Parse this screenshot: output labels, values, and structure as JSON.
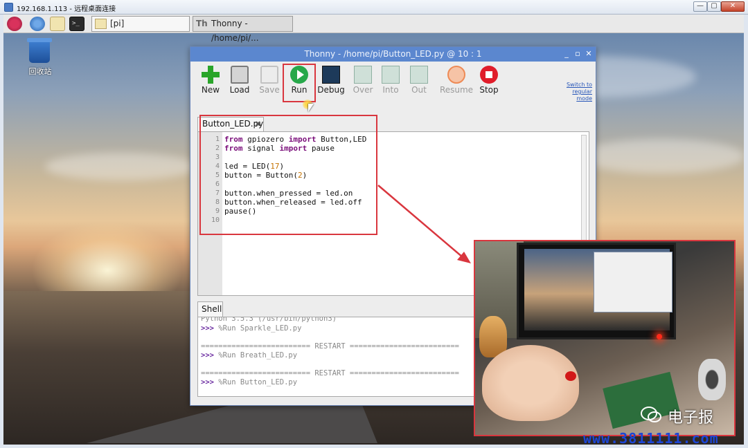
{
  "rdp": {
    "title": "192.168.1.113 - 远程桌面连接",
    "controls": {
      "minimize": "—",
      "maximize": "▢",
      "close": "✕"
    }
  },
  "taskbar": {
    "terminal_glyph": ">_",
    "tasks": [
      {
        "label": "[pi]"
      },
      {
        "label": "Thonny  -  /home/pi/..."
      }
    ]
  },
  "desktop": {
    "trash_label": "回收站"
  },
  "thonny": {
    "title": "Thonny  -  /home/pi/Button_LED.py  @  10 : 1",
    "window_controls": {
      "minimize": "_",
      "maximize": "▫",
      "close": "✕"
    },
    "toolbar": [
      {
        "label": "New",
        "enabled": true
      },
      {
        "label": "Load",
        "enabled": true
      },
      {
        "label": "Save",
        "enabled": false
      },
      {
        "label": "Run",
        "enabled": true
      },
      {
        "label": "Debug",
        "enabled": true
      },
      {
        "label": "Over",
        "enabled": false
      },
      {
        "label": "Into",
        "enabled": false
      },
      {
        "label": "Out",
        "enabled": false
      },
      {
        "label": "Resume",
        "enabled": false
      },
      {
        "label": "Stop",
        "enabled": true
      }
    ],
    "switch_mode": "Switch to regular mode",
    "editor": {
      "tab_label": "Button_LED.py",
      "tab_close": "✖",
      "line_numbers": [
        "1",
        "2",
        "3",
        "4",
        "5",
        "6",
        "7",
        "8",
        "9",
        "10"
      ],
      "code": [
        "from gpiozero import Button,LED",
        "from signal import pause",
        "",
        "led = LED(17)",
        "button = Button(2)",
        "",
        "button.when_pressed = led.on",
        "button.when_released = led.off",
        "pause()",
        ""
      ]
    },
    "shell": {
      "tab_label": "Shell",
      "lines": [
        "Python 3.5.3 (/usr/bin/python3)",
        ">>> %Run Sparkle_LED.py",
        "",
        "========================= RESTART =========================",
        ">>> %Run Breath_LED.py",
        "",
        "========================= RESTART =========================",
        ">>> %Run Button_LED.py"
      ]
    }
  },
  "watermark": {
    "brand": "电子报",
    "url": "www.3811111.com"
  },
  "colors": {
    "highlight_red": "#d9363e",
    "thonny_title_blue": "#5b87cf",
    "run_green": "#27a84a",
    "stop_red": "#e01d2a",
    "keyword_purple": "#7a0e7a",
    "url_blue": "#1c46d6"
  }
}
